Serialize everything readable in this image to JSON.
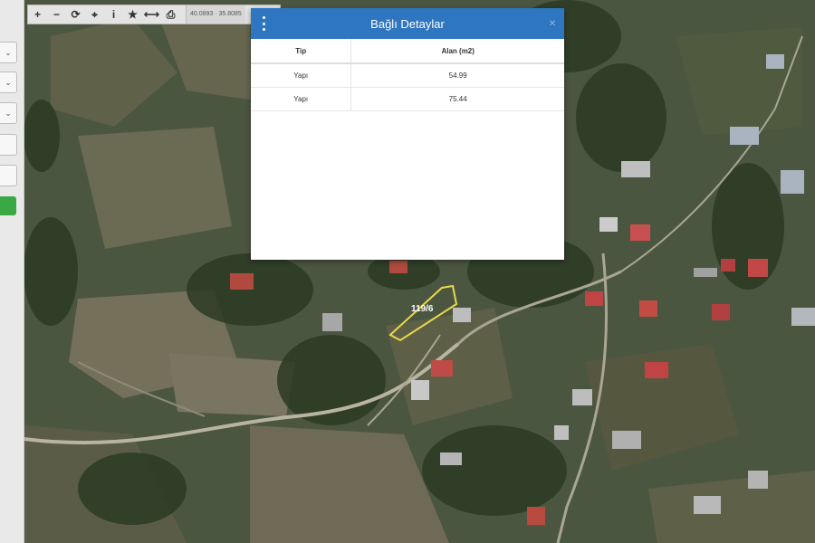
{
  "toolbar": {
    "buttons": [
      {
        "name": "zoom-in-button",
        "icon": "plus-icon",
        "glyph": "+"
      },
      {
        "name": "zoom-out-button",
        "icon": "minus-icon",
        "glyph": "−"
      },
      {
        "name": "refresh-button",
        "icon": "refresh-icon",
        "glyph": "⟳"
      },
      {
        "name": "locate-button",
        "icon": "crosshair-icon",
        "glyph": "⌖"
      },
      {
        "name": "info-button",
        "icon": "info-icon",
        "glyph": "i"
      },
      {
        "name": "favorite-button",
        "icon": "star-icon",
        "glyph": "★"
      },
      {
        "name": "measure-button",
        "icon": "measure-icon",
        "glyph": "⟷"
      },
      {
        "name": "print-button",
        "icon": "print-icon",
        "glyph": "⎙"
      }
    ],
    "coordinates": "40.0893 · 35.8085"
  },
  "modal": {
    "title": "Bağlı Detaylar",
    "columns": [
      "Tip",
      "Alan (m2)"
    ],
    "rows": [
      [
        "Yapı",
        "54.99"
      ],
      [
        "Yapı",
        "75.44"
      ]
    ],
    "close_glyph": "×"
  },
  "map": {
    "parcel_label": "119/6",
    "parcel_color": "#e8d84a"
  }
}
